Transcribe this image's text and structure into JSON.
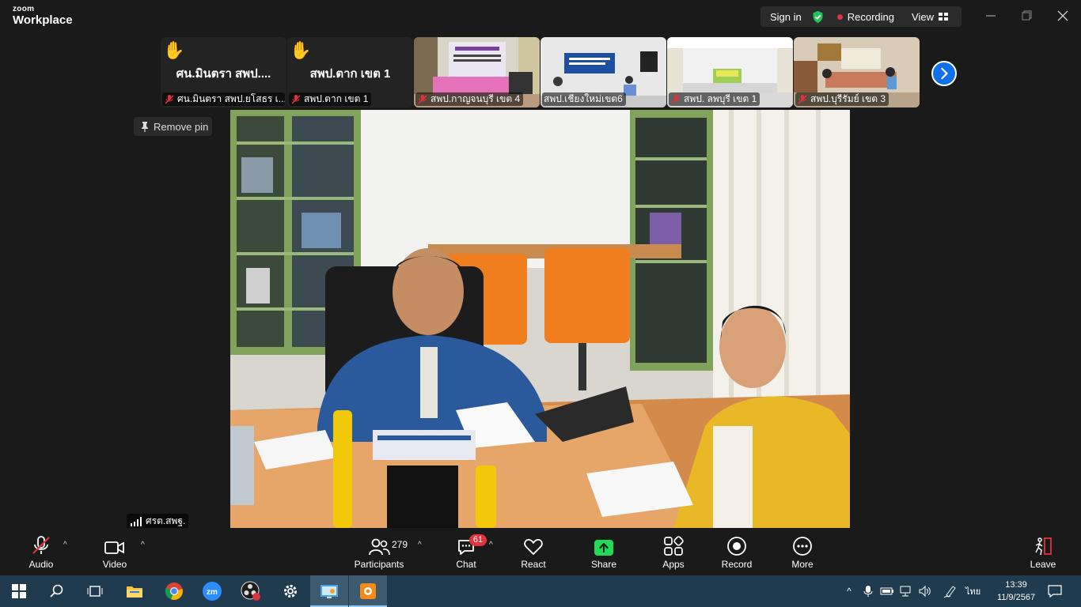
{
  "app": {
    "brand_small": "zoom",
    "brand_large": "Workplace"
  },
  "header": {
    "sign_in": "Sign in",
    "recording": "Recording",
    "view": "View"
  },
  "tiles": [
    {
      "big_name": "ศน.มินตรา สพป....",
      "label": "ศน.มินตรา สพป.ยโสธร เ...",
      "hand": "✋"
    },
    {
      "big_name": "สพป.ตาก เขต 1",
      "label": "สพป.ตาก เขต 1",
      "hand": "✋"
    },
    {
      "label": "สพป.กาญจนบุรี เขต 4"
    },
    {
      "label": "สพป.เชียงใหม่เขต6"
    },
    {
      "label": "สพป. ลพบุรี เขต 1"
    },
    {
      "label": "สพป.บุรีรัมย์ เขต 3"
    }
  ],
  "pin": {
    "remove_pin": "Remove pin"
  },
  "main": {
    "speaker_name": "ศรต.สพฐ."
  },
  "toolbar": {
    "audio": "Audio",
    "video": "Video",
    "participants": "Participants",
    "participants_count": "279",
    "chat": "Chat",
    "chat_badge": "61",
    "react": "React",
    "share": "Share",
    "apps": "Apps",
    "record": "Record",
    "more": "More",
    "leave": "Leave"
  },
  "taskbar": {
    "ime": "ไทย",
    "time": "13:39",
    "date": "11/9/2567"
  },
  "colors": {
    "accent_blue": "#0e71eb",
    "share_green": "#23d959",
    "recording_red": "#e0333d",
    "shield_green": "#23c35a"
  }
}
